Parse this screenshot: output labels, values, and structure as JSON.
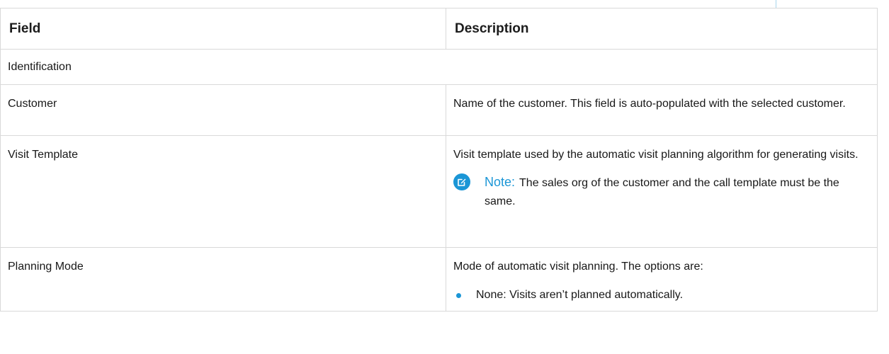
{
  "table": {
    "headers": {
      "field": "Field",
      "description": "Description"
    },
    "section": "Identification",
    "rows": [
      {
        "field": "Customer",
        "description": "Name of the customer. This field is auto-populated with the selected customer."
      },
      {
        "field": "Visit Template",
        "description": "Visit template used by the automatic visit planning algorithm for generating visits.",
        "note": {
          "label": "Note:",
          "text": "The sales org of the customer and the call template must be the same."
        }
      },
      {
        "field": "Planning Mode",
        "description": "Mode of automatic visit planning. The options are:",
        "bullets": [
          "None: Visits aren’t planned automatically."
        ]
      }
    ]
  },
  "icons": {
    "note": "note-edit-icon",
    "bullet": "bullet-dot-icon"
  },
  "colors": {
    "accent": "#1b96d6",
    "border": "#d9d9d9",
    "text": "#181818"
  }
}
